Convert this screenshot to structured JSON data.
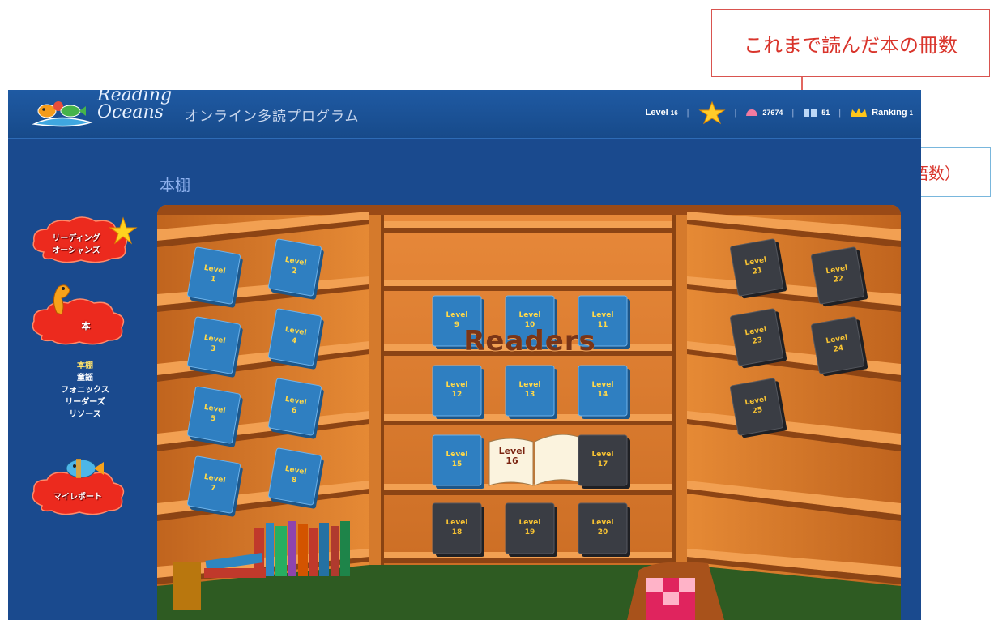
{
  "annotations": {
    "books_read": "これまで読んだ本の冊数",
    "shells": "シェル数（これまで読んだ総語数）"
  },
  "header": {
    "logo_line1": "Reading",
    "logo_line2": "Oceans",
    "subtitle": "オンライン多読プログラム",
    "level_label": "Level",
    "level_value": "16",
    "shells": "27674",
    "books": "51",
    "ranking_label": "Ranking",
    "ranking_value": "1"
  },
  "sidebar": {
    "cloud1_label_line1": "リーディング",
    "cloud1_label_line2": "オーシャンズ",
    "cloud2_label": "本",
    "cloud3_label": "マイレポート",
    "submenu": [
      "本棚",
      "童謡",
      "フォニックス",
      "リーダーズ",
      "リソース"
    ],
    "active_index": 0
  },
  "page": {
    "heading": "本棚"
  },
  "shelf": {
    "title": "Readers",
    "book_word": "Level",
    "levels": [
      "1",
      "2",
      "3",
      "4",
      "5",
      "6",
      "7",
      "8",
      "9",
      "10",
      "11",
      "12",
      "13",
      "14",
      "15",
      "16",
      "17",
      "18",
      "19",
      "20",
      "21",
      "22",
      "23",
      "24",
      "25"
    ],
    "current_level": "16",
    "colors": {
      "unlocked": "#2f7fc1",
      "locked": "#3a3d44",
      "label": "#ffd94a"
    }
  }
}
